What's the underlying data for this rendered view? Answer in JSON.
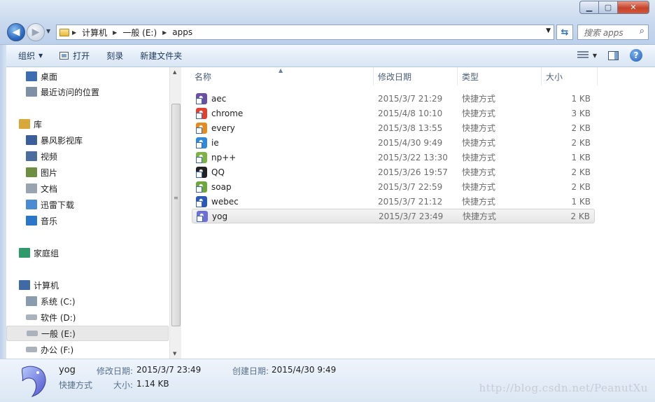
{
  "address": {
    "segments": [
      "计算机",
      "一般 (E:)",
      "apps"
    ]
  },
  "search": {
    "placeholder": "搜索 apps"
  },
  "toolbar": {
    "organize": "组织",
    "open": "打开",
    "burn": "刻录",
    "new_folder": "新建文件夹"
  },
  "nav": [
    {
      "label": "桌面",
      "icon": "desktop-icon",
      "indent": 1
    },
    {
      "label": "最近访问的位置",
      "icon": "recent-places-icon",
      "indent": 1
    },
    {
      "label": "库",
      "icon": "library-icon",
      "indent": 0
    },
    {
      "label": "暴风影视库",
      "icon": "video-library-icon",
      "indent": 1
    },
    {
      "label": "视频",
      "icon": "videos-icon",
      "indent": 1
    },
    {
      "label": "图片",
      "icon": "pictures-icon",
      "indent": 1
    },
    {
      "label": "文档",
      "icon": "documents-icon",
      "indent": 1
    },
    {
      "label": "迅雷下载",
      "icon": "thunder-download-icon",
      "indent": 1
    },
    {
      "label": "音乐",
      "icon": "music-icon",
      "indent": 1
    },
    {
      "label": "家庭组",
      "icon": "homegroup-icon",
      "indent": 0
    },
    {
      "label": "计算机",
      "icon": "computer-icon",
      "indent": 0
    },
    {
      "label": "系统 (C:)",
      "icon": "system-drive-icon",
      "indent": 1
    },
    {
      "label": "软件 (D:)",
      "icon": "drive-icon",
      "indent": 1
    },
    {
      "label": "一般 (E:)",
      "icon": "drive-icon",
      "indent": 1,
      "selected": true
    },
    {
      "label": "办公 (F:)",
      "icon": "drive-icon",
      "indent": 1
    }
  ],
  "columns": {
    "name": "名称",
    "date": "修改日期",
    "type": "类型",
    "size": "大小"
  },
  "files": [
    {
      "name": "aec",
      "date": "2015/3/7 21:29",
      "type": "快捷方式",
      "size": "1 KB",
      "color": "#6a4fa3"
    },
    {
      "name": "chrome",
      "date": "2015/4/8 10:10",
      "type": "快捷方式",
      "size": "3 KB",
      "color": "#e0402f"
    },
    {
      "name": "every",
      "date": "2015/3/8 13:55",
      "type": "快捷方式",
      "size": "2 KB",
      "color": "#e58a1f"
    },
    {
      "name": "ie",
      "date": "2015/4/30 9:49",
      "type": "快捷方式",
      "size": "2 KB",
      "color": "#2f8ad8"
    },
    {
      "name": "np++",
      "date": "2015/3/22 13:30",
      "type": "快捷方式",
      "size": "1 KB",
      "color": "#7cb342"
    },
    {
      "name": "QQ",
      "date": "2015/3/26 19:57",
      "type": "快捷方式",
      "size": "2 KB",
      "color": "#222222"
    },
    {
      "name": "soap",
      "date": "2015/3/7 22:59",
      "type": "快捷方式",
      "size": "2 KB",
      "color": "#6fa83a"
    },
    {
      "name": "webec",
      "date": "2015/3/7 21:12",
      "type": "快捷方式",
      "size": "1 KB",
      "color": "#2c59b5"
    },
    {
      "name": "yog",
      "date": "2015/3/7 23:49",
      "type": "快捷方式",
      "size": "2 KB",
      "color": "#6d6fd8",
      "selected": true
    }
  ],
  "details": {
    "name": "yog",
    "kind": "快捷方式",
    "modified_label": "修改日期:",
    "modified_value": "2015/3/7 23:49",
    "created_label": "创建日期:",
    "created_value": "2015/4/30 9:49",
    "size_label": "大小:",
    "size_value": "1.14 KB"
  },
  "watermark": "http://blog.csdn.net/PeanutXu"
}
